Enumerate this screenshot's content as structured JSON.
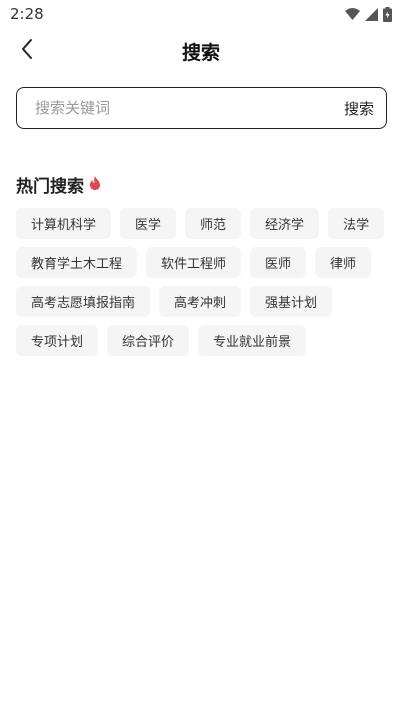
{
  "status_bar": {
    "time": "2:28",
    "icons": [
      "wifi-icon",
      "signal-icon",
      "battery-icon"
    ]
  },
  "header": {
    "title": "搜索",
    "back_icon": "chevron-left-icon"
  },
  "search": {
    "placeholder": "搜索关键词",
    "value": "",
    "button_label": "搜索"
  },
  "hot": {
    "title": "热门搜索",
    "icon": "flame-icon",
    "icon_color": "#e0484f",
    "tags": [
      "计算机科学",
      "医学",
      "师范",
      "经济学",
      "法学",
      "教育学土木工程",
      "软件工程师",
      "医师",
      "律师",
      "高考志愿填报指南",
      "高考冲刺",
      "强基计划",
      "专项计划",
      "综合评价",
      "专业就业前景"
    ]
  }
}
